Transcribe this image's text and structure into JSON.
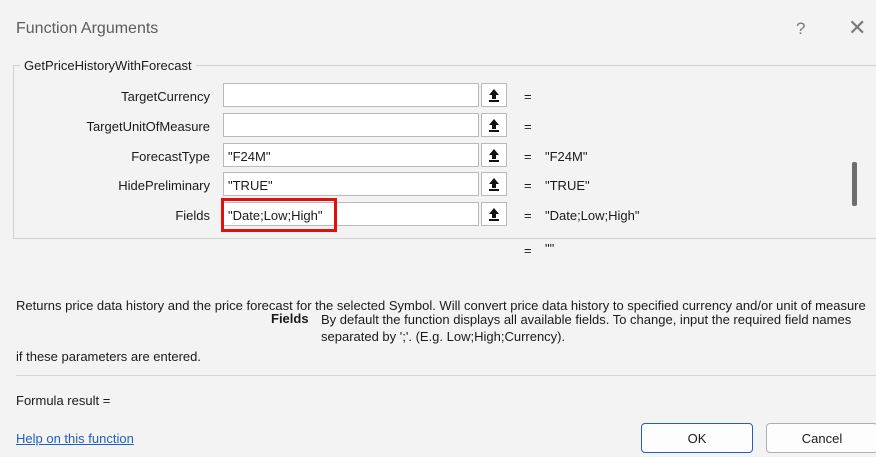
{
  "window": {
    "title": "Function Arguments",
    "help_glyph": "?",
    "close_glyph": "✕"
  },
  "function": {
    "name": "GetPriceHistoryWithForecast"
  },
  "args": [
    {
      "label": "TargetCurrency",
      "value": "",
      "result": ""
    },
    {
      "label": "TargetUnitOfMeasure",
      "value": "",
      "result": ""
    },
    {
      "label": "ForecastType",
      "value": "\"F24M\"",
      "result": "\"F24M\""
    },
    {
      "label": "HidePreliminary",
      "value": "\"TRUE\"",
      "result": "\"TRUE\""
    },
    {
      "label": "Fields",
      "value": "\"Date;Low;High\"",
      "result": "\"Date;Low;High\""
    }
  ],
  "equals_sign": "=",
  "function_result": "\"\"",
  "description": {
    "line1": "Returns price data history and the price forecast for the selected Symbol. Will convert price data history to specified currency and/or unit of measure",
    "line2": "if these parameters are entered."
  },
  "arg_help": {
    "name": "Fields",
    "text": "By default the function displays all available fields. To change, input the required field names separated by ';'. (E.g. Low;High;Currency)."
  },
  "formula_result_label": "Formula result =",
  "help_link": "Help on this function",
  "buttons": {
    "ok": "OK",
    "cancel": "Cancel"
  },
  "colors": {
    "highlight": "#e01010",
    "link": "#1f5fbf",
    "ok_border": "#1f5fbf"
  },
  "icons": {
    "collapse": "upload-arrow-icon"
  }
}
